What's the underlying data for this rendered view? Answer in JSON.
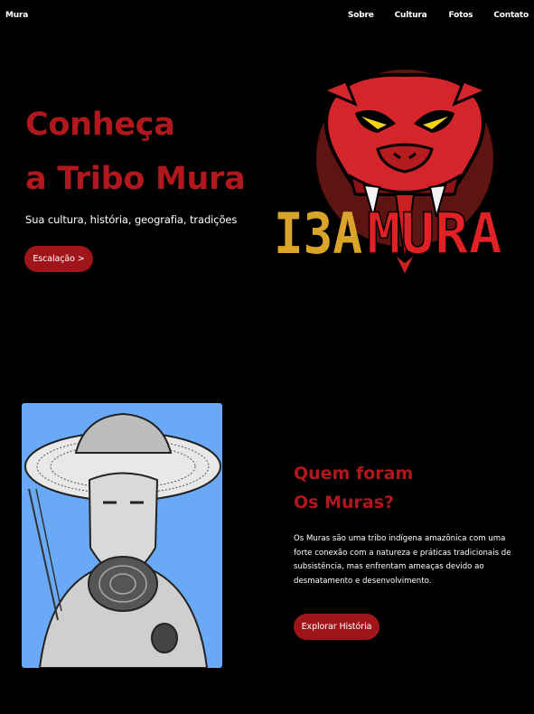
{
  "nav": {
    "brand": "Mura",
    "links": [
      "Sobre",
      "Cultura",
      "Fotos",
      "Contato"
    ]
  },
  "hero": {
    "title_line1": "Conheça",
    "title_line2": "a Tribo Mura",
    "subtitle": "Sua cultura, história, geografia, tradições",
    "button_label": "Escalação >"
  },
  "logo": {
    "text_left": "I3A",
    "text_right": "MURA"
  },
  "about": {
    "title_line1": "Quem foram",
    "title_line2": "Os Muras?",
    "text": "Os Muras são uma tribo indígena amazônica com uma forte conexão com a natureza e práticas tradicionais de subsistência, mas enfrentam ameaças devido ao desmatamento e desenvolvimento.",
    "button_label": "Explorar História"
  },
  "colors": {
    "background": "#000000",
    "accent": "#b0181d",
    "button": "#a01519",
    "portrait_bg": "#69a9f5",
    "logo_gold": "#d9a42a"
  }
}
